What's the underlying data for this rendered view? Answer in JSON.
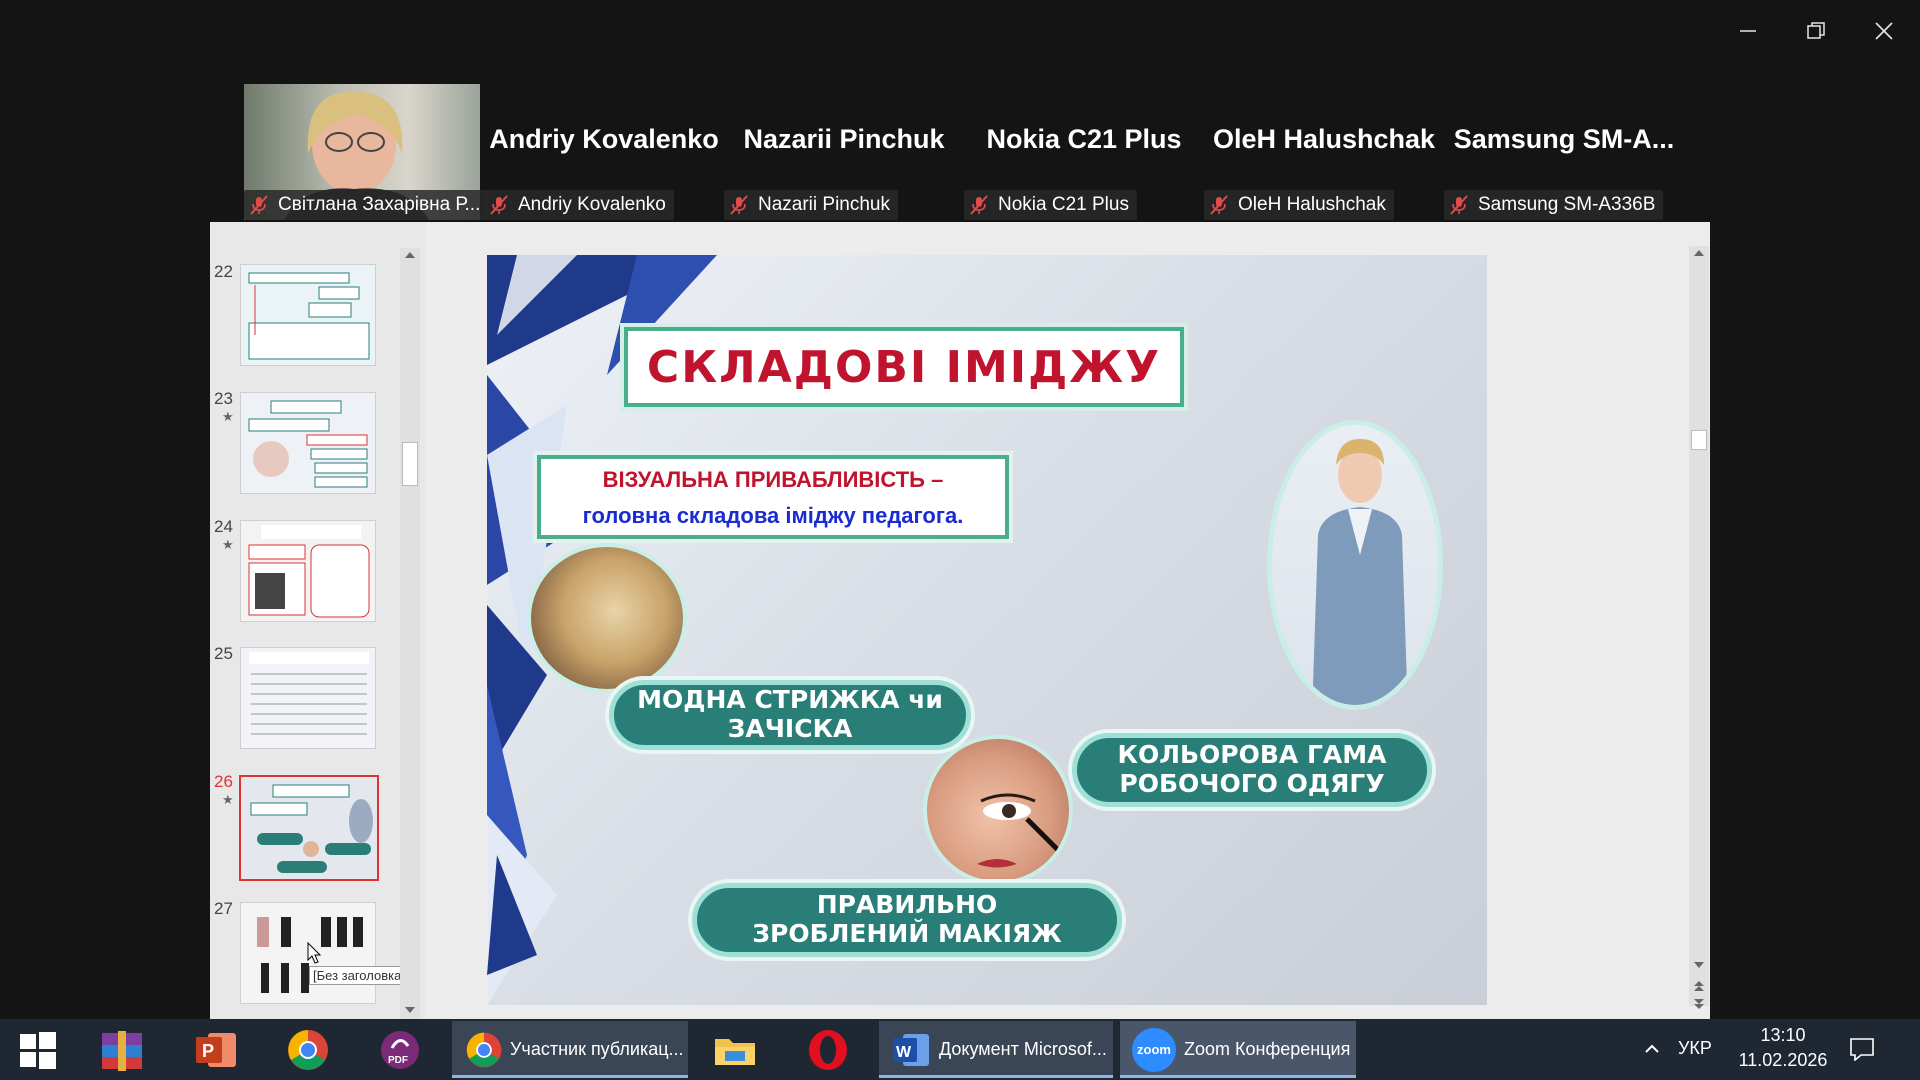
{
  "window": {
    "minimize_icon": "minimize-icon",
    "restore_icon": "restore-icon",
    "close_icon": "close-icon"
  },
  "participants": [
    {
      "display_name": "",
      "label": "Світлана Захарівна Р...",
      "has_video": true
    },
    {
      "display_name": "Andriy Kovalenko",
      "label": "Andriy Kovalenko"
    },
    {
      "display_name": "Nazarii Pinchuk",
      "label": "Nazarii Pinchuk"
    },
    {
      "display_name": "Nokia C21 Plus",
      "label": "Nokia C21 Plus"
    },
    {
      "display_name": "OleH Halushchak",
      "label": "OleH Halushchak"
    },
    {
      "display_name": "Samsung  SM-A...",
      "label": "Samsung SM-A336B"
    }
  ],
  "ppt": {
    "more_icon": "more-icon",
    "pin_icon": "pin-icon",
    "close_icon": "close-icon",
    "thumbnails": [
      {
        "num": "22",
        "star": ""
      },
      {
        "num": "23",
        "star": "★"
      },
      {
        "num": "24",
        "star": "★"
      },
      {
        "num": "25",
        "star": ""
      },
      {
        "num": "26",
        "star": "★"
      },
      {
        "num": "27",
        "star": ""
      }
    ],
    "tooltip": "[Без заголовка]",
    "slide": {
      "title": "СКЛАДОВІ ІМІДЖУ",
      "subtitle_line1": "ВІЗУАЛЬНА ПРИВАБЛИВІСТЬ –",
      "subtitle_line2": "головна складова іміджу педагога.",
      "pill_hair": "МОДНА СТРИЖКА чи ЗАЧІСКА",
      "pill_color": "КОЛЬОРОВА ГАМА РОБОЧОГО ОДЯГУ",
      "pill_makeup": "ПРАВИЛЬНО ЗРОБЛЕНИЙ МАКІЯЖ"
    }
  },
  "taskbar": {
    "tasks": [
      {
        "label": "Участник публикац..."
      },
      {
        "label": "Документ Microsof..."
      },
      {
        "label": "Zoom Конференция"
      }
    ],
    "zoom_logo": "zoom",
    "lang": "УКР",
    "time": "13:10",
    "date": "11.02.2026"
  },
  "colors": {
    "title_red": "#c0142e",
    "subtitle_blue": "#1a2bd0",
    "pill_teal": "#2a7e78",
    "pill_border": "#9ee0d6",
    "selected_border": "#dd3333"
  }
}
